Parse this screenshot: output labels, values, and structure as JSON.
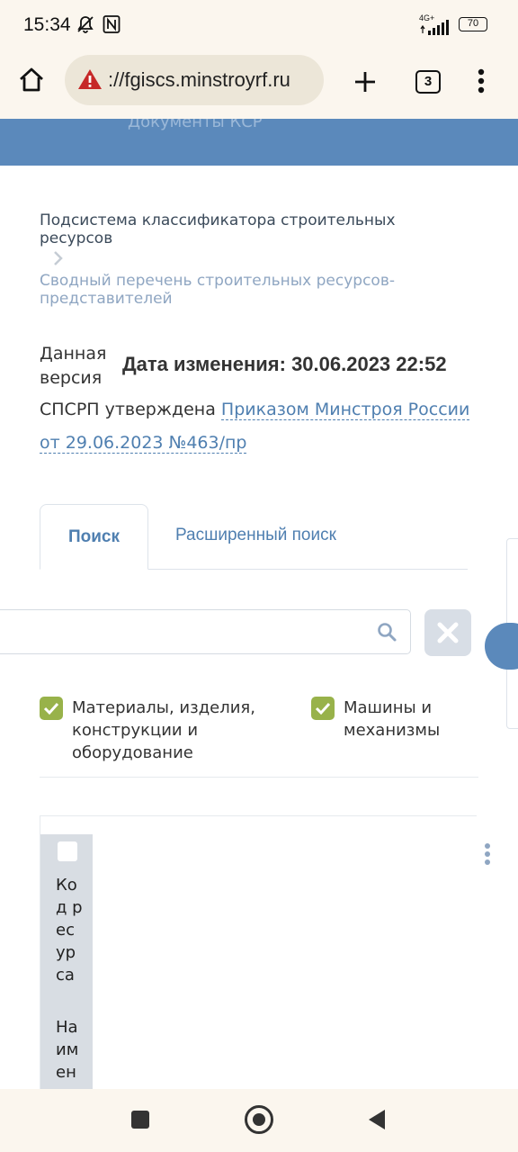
{
  "status_bar": {
    "time": "15:34",
    "network": "4G+",
    "battery": "70"
  },
  "browser": {
    "url": "://fgiscs.minstroyrf.ru",
    "tab_count": "3"
  },
  "header": {
    "link_text": "Документы КСР"
  },
  "breadcrumb": {
    "level1": "Подсистема классификатора строительных ресурсов",
    "level2": "Сводный перечень строительных ресурсов-представителей"
  },
  "version": {
    "label": "Данная версия",
    "date_label": "Дата изменения: 30.06.2023 22:52",
    "approved_prefix": "СПСРП утверждена",
    "approved_link": "Приказом Минстроя России от 29.06.2023 №463/пр"
  },
  "tabs": [
    {
      "label": "Поиск",
      "active": true
    },
    {
      "label": "Расширенный поиск",
      "active": false
    }
  ],
  "search": {
    "value": "",
    "placeholder": ""
  },
  "filters": [
    {
      "label": "Материалы, изделия, конструкции и оборудование",
      "checked": true
    },
    {
      "label": "Машины и механизмы",
      "checked": true
    }
  ],
  "table": {
    "columns": [
      "Код ресурса",
      "Наимен"
    ]
  },
  "colors": {
    "accent": "#5b89bb",
    "link": "#4f7fb0",
    "checkbox": "#98b24a"
  }
}
